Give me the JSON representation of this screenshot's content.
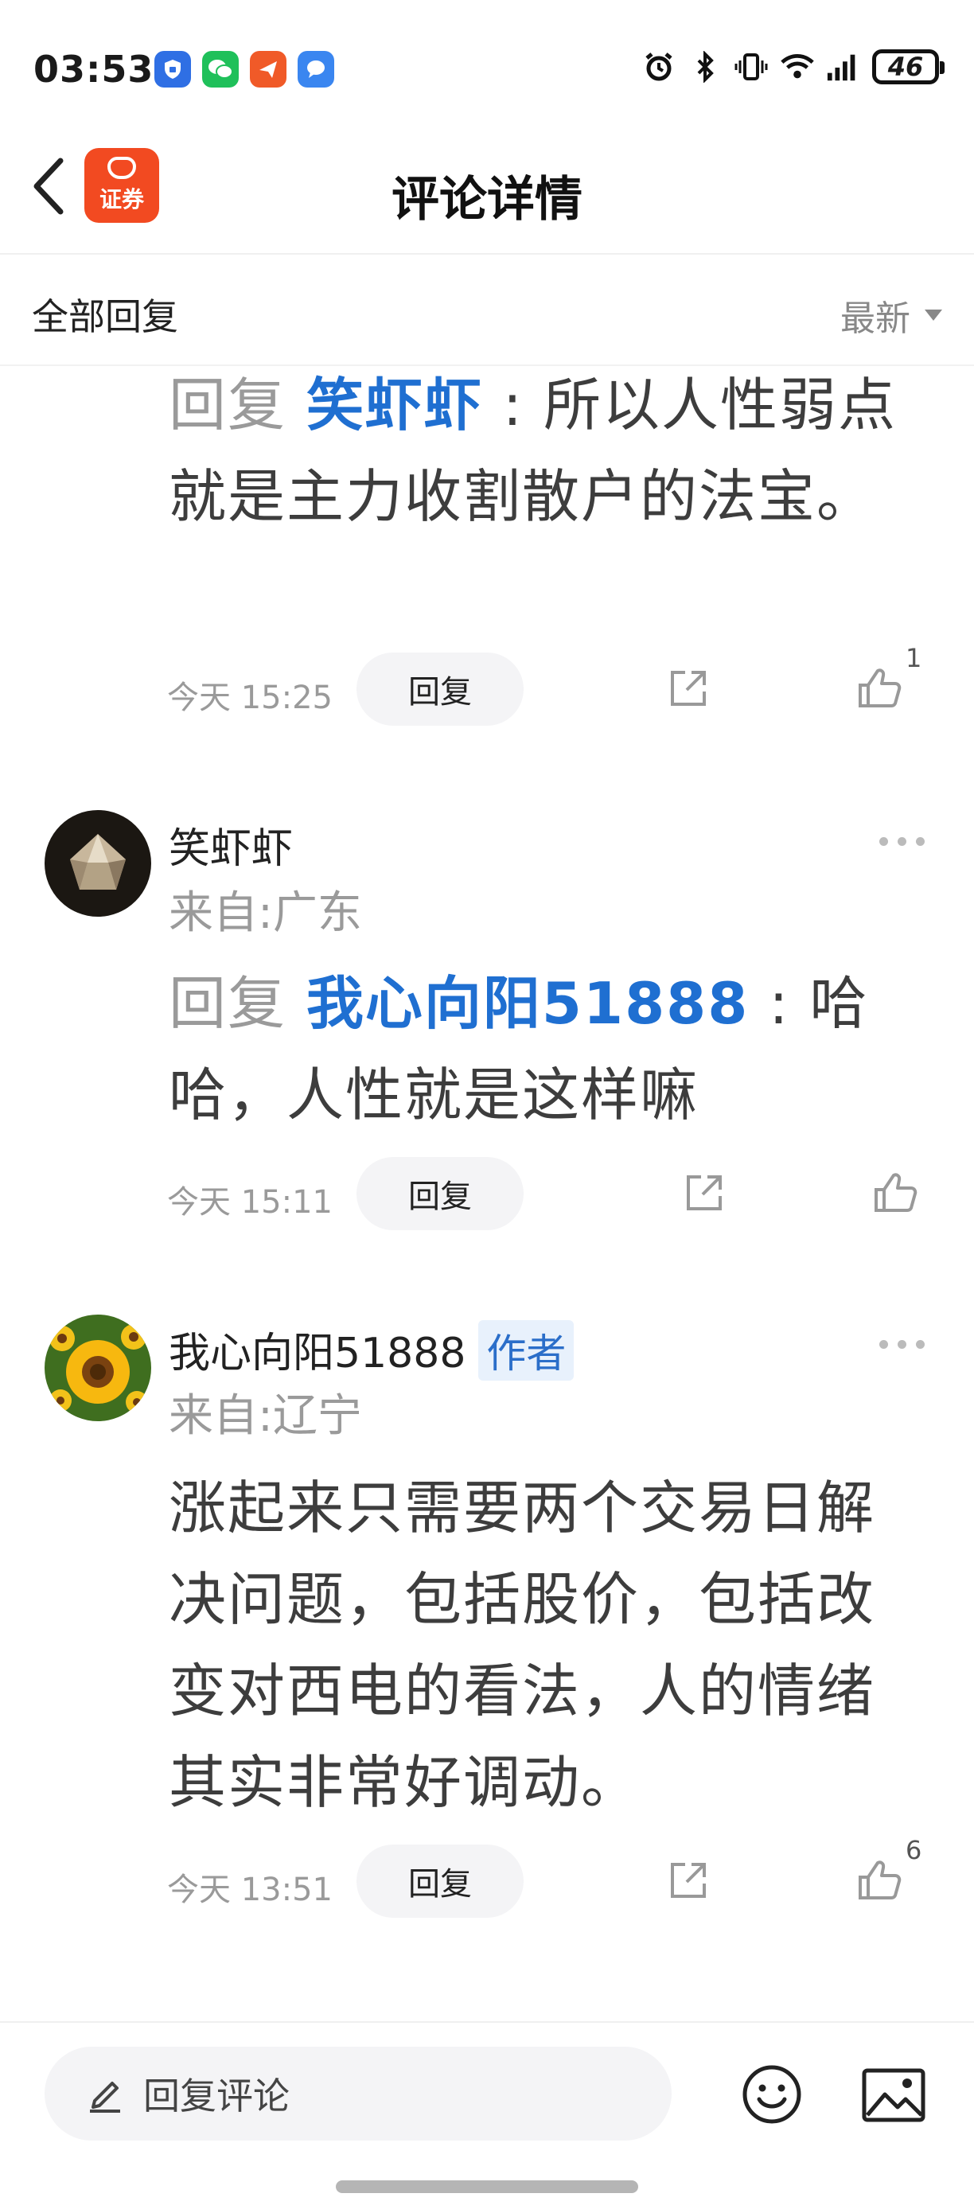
{
  "status_bar": {
    "time": "03:53",
    "notification_icons": [
      "shield-app-icon",
      "wechat-icon",
      "paper-plane-app-icon",
      "chat-bubble-app-icon"
    ],
    "right_icons": [
      "alarm-icon",
      "bluetooth-icon",
      "vibrate-icon",
      "wifi-icon",
      "signal-icon"
    ],
    "battery": "46"
  },
  "header": {
    "app_logo_text": "证券",
    "title": "评论详情"
  },
  "filter": {
    "label": "全部回复",
    "sort_label": "最新"
  },
  "comments": [
    {
      "reply_prefix": "回复 ",
      "reply_target": "笑虾虾",
      "text": " : 所以人性弱点就是主力收割散户的法宝。",
      "time": "今天 15:25",
      "reply_label": "回复",
      "likes": "1"
    },
    {
      "username": "笑虾虾",
      "location": "来自:广东",
      "reply_prefix": "回复 ",
      "reply_target": "我心向阳51888",
      "text": " : 哈哈，人性就是这样嘛",
      "time": "今天 15:11",
      "reply_label": "回复",
      "likes": ""
    },
    {
      "username": "我心向阳51888",
      "author_tag": "作者",
      "location": "来自:辽宁",
      "text": "涨起来只需要两个交易日解决问题，包括股价，包括改变对西电的看法，人的情绪其实非常好调动。",
      "time": "今天 13:51",
      "reply_label": "回复",
      "likes": "6"
    }
  ],
  "bottom_bar": {
    "input_placeholder": "回复评论"
  },
  "colors": {
    "accent_blue": "#1f6fd1",
    "logo_orange": "#f24a21",
    "muted_gray": "#9a9a9a"
  }
}
